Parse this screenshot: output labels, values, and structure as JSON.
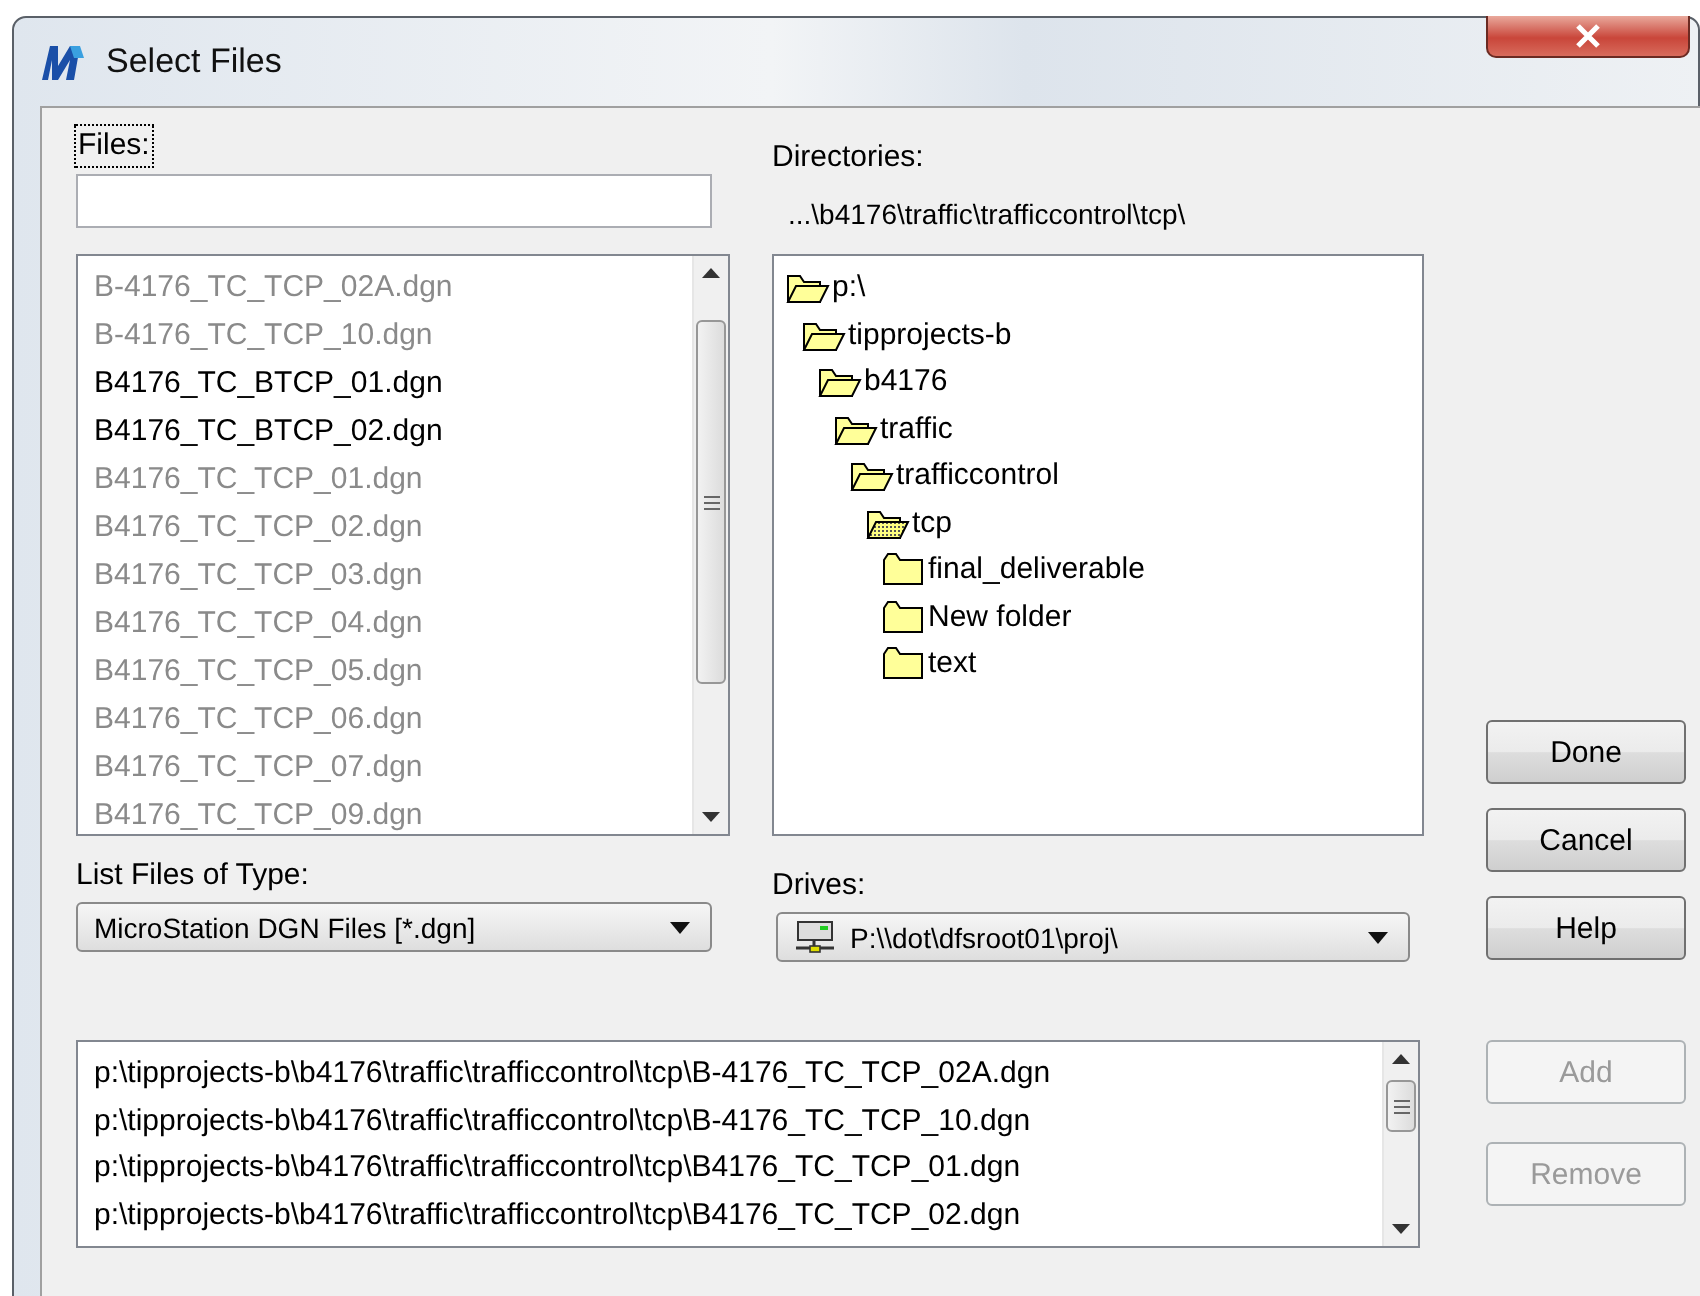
{
  "window": {
    "title": "Select Files"
  },
  "files": {
    "label": "Files:",
    "items": [
      {
        "name": "B-4176_TC_TCP_02A.dgn",
        "dimmed": true
      },
      {
        "name": "B-4176_TC_TCP_10.dgn",
        "dimmed": true
      },
      {
        "name": "B4176_TC_BTCP_01.dgn",
        "dimmed": false
      },
      {
        "name": "B4176_TC_BTCP_02.dgn",
        "dimmed": false
      },
      {
        "name": "B4176_TC_TCP_01.dgn",
        "dimmed": true
      },
      {
        "name": "B4176_TC_TCP_02.dgn",
        "dimmed": true
      },
      {
        "name": "B4176_TC_TCP_03.dgn",
        "dimmed": true
      },
      {
        "name": "B4176_TC_TCP_04.dgn",
        "dimmed": true
      },
      {
        "name": "B4176_TC_TCP_05.dgn",
        "dimmed": true
      },
      {
        "name": "B4176_TC_TCP_06.dgn",
        "dimmed": true
      },
      {
        "name": "B4176_TC_TCP_07.dgn",
        "dimmed": true
      },
      {
        "name": "B4176_TC_TCP_09.dgn",
        "dimmed": true
      }
    ]
  },
  "directories": {
    "label": "Directories:",
    "path": "...\\b4176\\traffic\\trafficcontrol\\tcp\\",
    "tree": [
      {
        "name": "p:\\",
        "expanded": true,
        "selected": false,
        "children": [
          {
            "name": "tipprojects-b",
            "expanded": true,
            "selected": false,
            "children": [
              {
                "name": "b4176",
                "expanded": true,
                "selected": false,
                "children": [
                  {
                    "name": "traffic",
                    "expanded": true,
                    "selected": false,
                    "children": [
                      {
                        "name": "trafficcontrol",
                        "expanded": true,
                        "selected": false,
                        "children": [
                          {
                            "name": "tcp",
                            "expanded": true,
                            "selected": true,
                            "children": [
                              {
                                "name": "final_deliverable",
                                "expanded": false,
                                "selected": false
                              },
                              {
                                "name": "New folder",
                                "expanded": false,
                                "selected": false
                              },
                              {
                                "name": "text",
                                "expanded": false,
                                "selected": false
                              }
                            ]
                          }
                        ]
                      }
                    ]
                  }
                ]
              }
            ]
          }
        ]
      }
    ]
  },
  "file_type": {
    "label": "List Files of Type:",
    "value": "MicroStation DGN Files [*.dgn]"
  },
  "drives": {
    "label": "Drives:",
    "value": "P:\\\\dot\\dfsroot01\\proj\\"
  },
  "buttons": [
    {
      "label": "Done",
      "disabled": false
    },
    {
      "label": "Cancel",
      "disabled": false
    },
    {
      "label": "Help",
      "disabled": false
    }
  ],
  "selected_files": [
    "p:\\tipprojects-b\\b4176\\traffic\\trafficcontrol\\tcp\\B-4176_TC_TCP_02A.dgn",
    "p:\\tipprojects-b\\b4176\\traffic\\trafficcontrol\\tcp\\B-4176_TC_TCP_10.dgn",
    "p:\\tipprojects-b\\b4176\\traffic\\trafficcontrol\\tcp\\B4176_TC_TCP_01.dgn",
    "p:\\tipprojects-b\\b4176\\traffic\\trafficcontrol\\tcp\\B4176_TC_TCP_02.dgn"
  ],
  "list_buttons": [
    {
      "label": "Add",
      "disabled": true
    },
    {
      "label": "Remove",
      "disabled": true
    }
  ]
}
